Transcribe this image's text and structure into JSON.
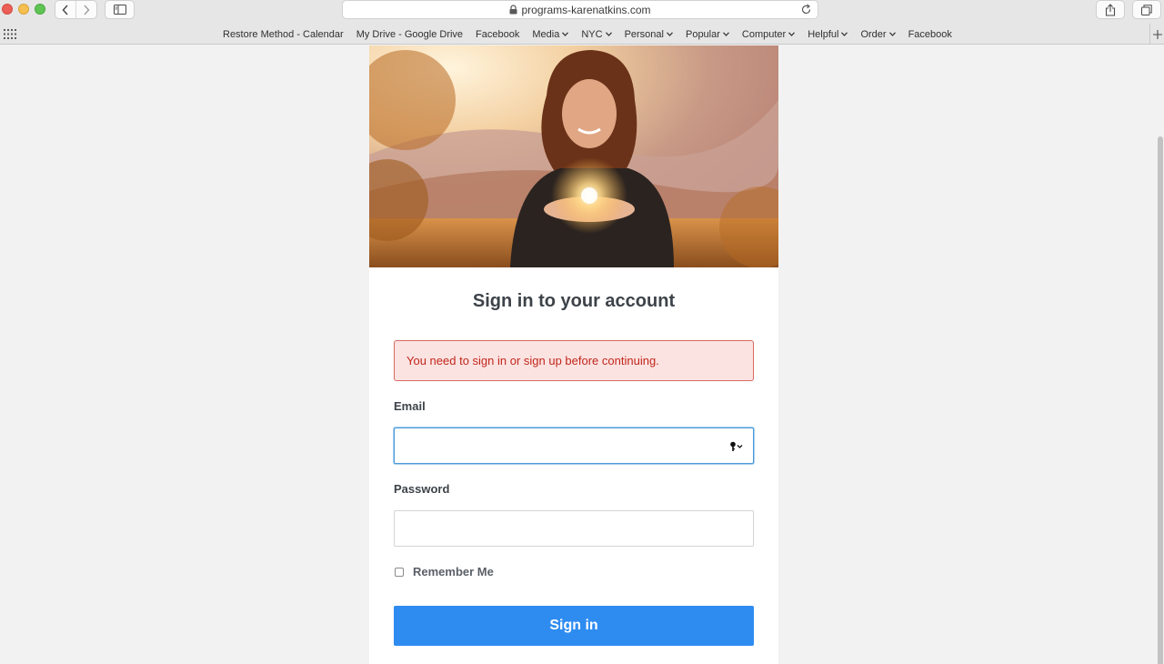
{
  "browser": {
    "url": "programs-karenatkins.com",
    "bookmarks": [
      {
        "label": "Restore Method - Calendar",
        "dropdown": false
      },
      {
        "label": "My Drive - Google Drive",
        "dropdown": false
      },
      {
        "label": "Facebook",
        "dropdown": false
      },
      {
        "label": "Media",
        "dropdown": true
      },
      {
        "label": "NYC",
        "dropdown": true
      },
      {
        "label": "Personal",
        "dropdown": true
      },
      {
        "label": "Popular",
        "dropdown": true
      },
      {
        "label": "Computer",
        "dropdown": true
      },
      {
        "label": "Helpful",
        "dropdown": true
      },
      {
        "label": "Order",
        "dropdown": true
      },
      {
        "label": "Facebook",
        "dropdown": false
      }
    ]
  },
  "login": {
    "title": "Sign in to your account",
    "alert": "You need to sign in or sign up before continuing.",
    "email_label": "Email",
    "email_value": "",
    "password_label": "Password",
    "password_value": "",
    "remember_label": "Remember Me",
    "remember_checked": false,
    "submit_label": "Sign in"
  },
  "colors": {
    "primary_button": "#2e8cf1",
    "alert_bg": "#fbe3e2",
    "alert_text": "#c2271b",
    "focus_border": "#4a9ad8"
  }
}
